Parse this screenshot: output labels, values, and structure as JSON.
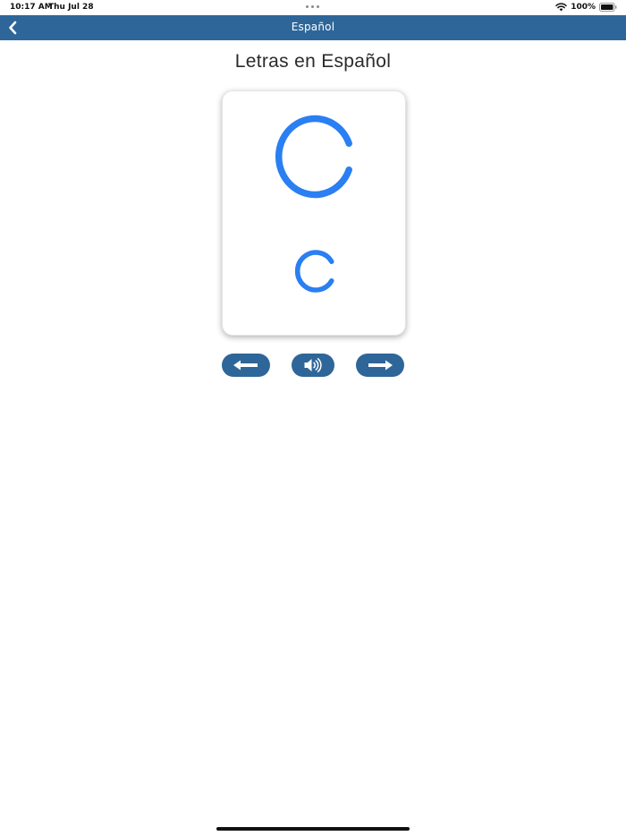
{
  "status_bar": {
    "time": "10:17 AM",
    "date": "Thu Jul 28",
    "battery": "100%"
  },
  "nav": {
    "title": "Español",
    "back_icon": "chevron-left-icon"
  },
  "page": {
    "title": "Letras en Español"
  },
  "card": {
    "uppercase": "C",
    "lowercase": "c",
    "letter_color": "#2a7ff2"
  },
  "controls": {
    "previous_icon": "arrow-left-icon",
    "sound_icon": "speaker-icon",
    "next_icon": "arrow-right-icon"
  },
  "colors": {
    "nav_bar": "#2e6699",
    "button": "#2e6699",
    "letter": "#2a7ff2"
  }
}
